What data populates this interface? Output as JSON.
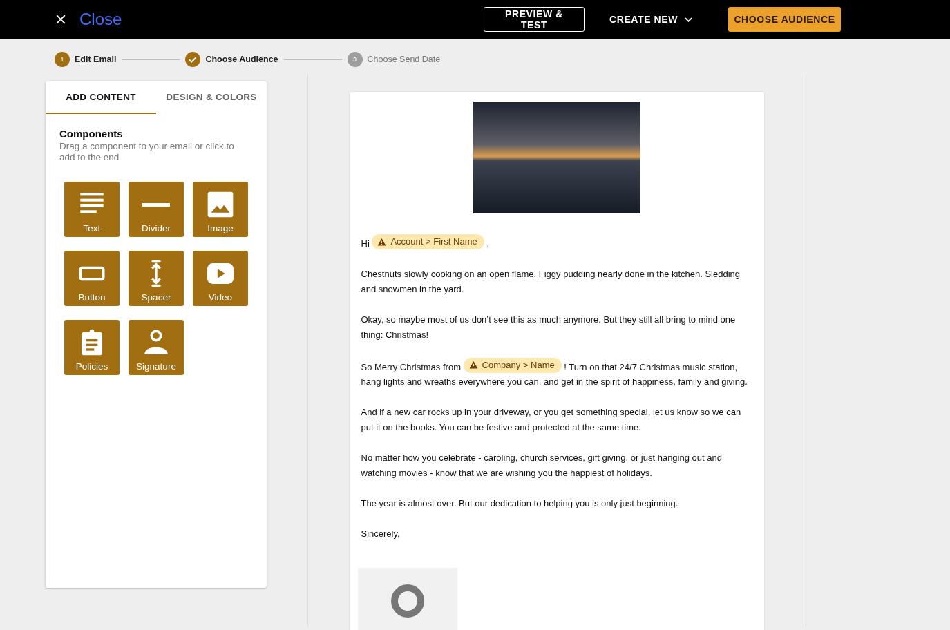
{
  "topbar": {
    "close_label": "Close",
    "buttons": [
      {
        "label": "PREVIEW & TEST",
        "kind": "outlined"
      },
      {
        "label": "CREATE NEW",
        "kind": "menu"
      },
      {
        "label": "CHOOSE AUDIENCE",
        "kind": "primary"
      }
    ]
  },
  "steps": [
    {
      "number": "1",
      "label": "Edit Email",
      "active": true,
      "done": false
    },
    {
      "label": "Choose Audience",
      "active": true,
      "done": true
    },
    {
      "number": "3",
      "label": "Choose Send Date",
      "active": false,
      "done": false
    }
  ],
  "sidebar": {
    "tabs": [
      {
        "label": "ADD CONTENT",
        "selected": true
      },
      {
        "label": "DESIGN & COLORS",
        "selected": false
      }
    ],
    "heading": "Components",
    "description": "Drag a component to your email or click to add to the end",
    "components": [
      {
        "label": "Text",
        "kind": "text"
      },
      {
        "label": "Divider",
        "kind": "divider"
      },
      {
        "label": "Image",
        "kind": "image"
      },
      {
        "label": "Button",
        "kind": "button"
      },
      {
        "label": "Spacer",
        "kind": "spacer"
      },
      {
        "label": "Video",
        "kind": "video"
      },
      {
        "label": "Policies",
        "kind": "policies"
      },
      {
        "label": "Signature",
        "kind": "signature"
      }
    ]
  },
  "email": {
    "paragraphs": [
      [
        {
          "kind": "text",
          "text": "Hi"
        },
        {
          "kind": "merge_tag",
          "text": "Account > First Name"
        },
        {
          "kind": "text",
          "text": ","
        }
      ],
      [
        {
          "kind": "text",
          "text": "Chestnuts slowly cooking on an open flame. Figgy pudding nearly done in the kitchen. Sledding and snowmen in the yard."
        }
      ],
      [
        {
          "kind": "text",
          "text": "Okay, so maybe most of us don’t see this as much anymore. But they still all bring to mind one thing: Christmas!"
        }
      ],
      [
        {
          "kind": "text",
          "text": "So Merry Christmas from"
        },
        {
          "kind": "merge_tag",
          "text": "Company > Name"
        },
        {
          "kind": "text",
          "text": "! Turn on that 24/7 Christmas music station, hang lights and wreaths everywhere you can, and get in the spirit of happiness, family and giving."
        }
      ],
      [
        {
          "kind": "text",
          "text": "And if a new car rocks up in your driveway, or you get something special, let us know so we can put it on the books. You can be festive and protected at the same time."
        }
      ],
      [
        {
          "kind": "text",
          "text": "No matter how you celebrate - caroling, church services, gift giving, or just hanging out and watching movies - know that we are wishing you the happiest of holidays."
        }
      ],
      [
        {
          "kind": "text",
          "text": "The year is almost over. But our dedication to helping you is only just beginning."
        }
      ],
      [
        {
          "kind": "text",
          "text": "Sincerely,"
        }
      ]
    ]
  }
}
